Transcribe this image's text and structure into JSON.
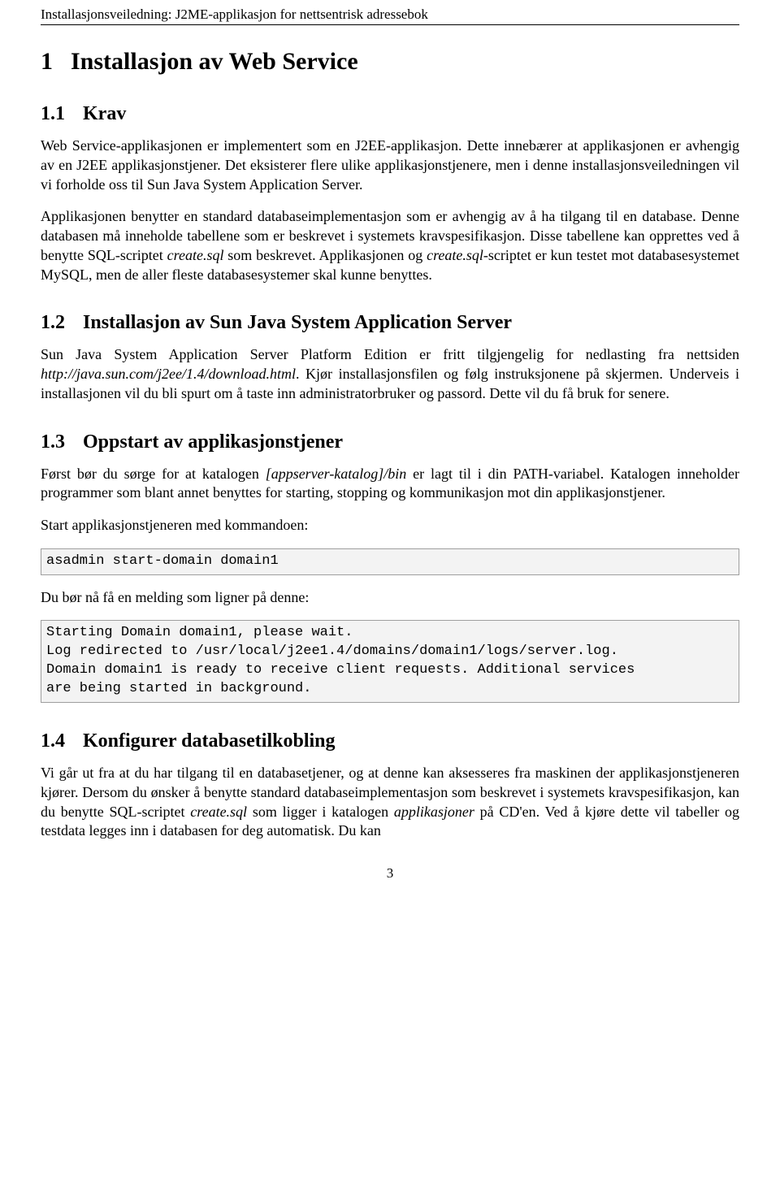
{
  "header": "Installasjonsveiledning: J2ME-applikasjon for nettsentrisk adressebok",
  "page_number": "3",
  "section1": {
    "number": "1",
    "title": "Installasjon av Web Service",
    "sub1": {
      "number": "1.1",
      "title": "Krav",
      "para1_a": "Web Service-applikasjonen er implementert som en J2EE-applikasjon. Dette innebærer at applikasjonen er avhengig av en J2EE applikasjonstjener. Det eksisterer flere ulike applikasjonstjenere, men i denne installasjonsveiledningen vil vi forholde oss til Sun Java System Application Server.",
      "para2_a": "Applikasjonen benytter en standard databaseimplementasjon som er avhengig av å ha tilgang til en database. Denne databasen må inneholde tabellene som er beskrevet i systemets kravspesifikasjon. Disse tabellene kan opprettes ved å benytte SQL-scriptet ",
      "para2_b": "create.sql",
      "para2_c": " som beskrevet. Applikasjonen og ",
      "para2_d": "create.sql",
      "para2_e": "-scriptet er kun testet mot databasesystemet MySQL, men de aller fleste databasesystemer skal kunne benyttes."
    },
    "sub2": {
      "number": "1.2",
      "title": "Installasjon av Sun Java System Application Server",
      "para1_a": "Sun Java System Application Server Platform Edition er fritt tilgjengelig for nedlasting fra nettsiden ",
      "para1_b": "http://java.sun.com/j2ee/1.4/download.html",
      "para1_c": ". Kjør installasjonsfilen og følg instruksjonene på skjermen. Underveis i installasjonen vil du bli spurt om å taste inn administratorbruker og passord. Dette vil du få bruk for senere."
    },
    "sub3": {
      "number": "1.3",
      "title": "Oppstart av applikasjonstjener",
      "para1_a": "Først bør du sørge for at katalogen ",
      "para1_b": "[appserver-katalog]/bin",
      "para1_c": " er lagt til i din PATH-variabel. Katalogen inneholder programmer som blant annet benyttes for starting, stopping og kommunikasjon mot din applikasjonstjener.",
      "lead1": "Start applikasjonstjeneren med kommandoen:",
      "code1": "asadmin start-domain domain1",
      "lead2": "Du bør nå få en melding som ligner på denne:",
      "code2": "Starting Domain domain1, please wait.\nLog redirected to /usr/local/j2ee1.4/domains/domain1/logs/server.log.\nDomain domain1 is ready to receive client requests. Additional services\nare being started in background."
    },
    "sub4": {
      "number": "1.4",
      "title": "Konfigurer databasetilkobling",
      "para1_a": "Vi går ut fra at du har tilgang til en databasetjener, og at denne kan aksesseres fra maskinen der applikasjonstjeneren kjører. Dersom du ønsker å benytte standard databaseimplementasjon som beskrevet i systemets kravspesifikasjon, kan du benytte SQL-scriptet ",
      "para1_b": "create.sql",
      "para1_c": " som ligger i katalogen ",
      "para1_d": "applikasjoner",
      "para1_e": " på CD'en. Ved å kjøre dette vil tabeller og testdata legges inn i databasen for deg automatisk. Du kan"
    }
  }
}
